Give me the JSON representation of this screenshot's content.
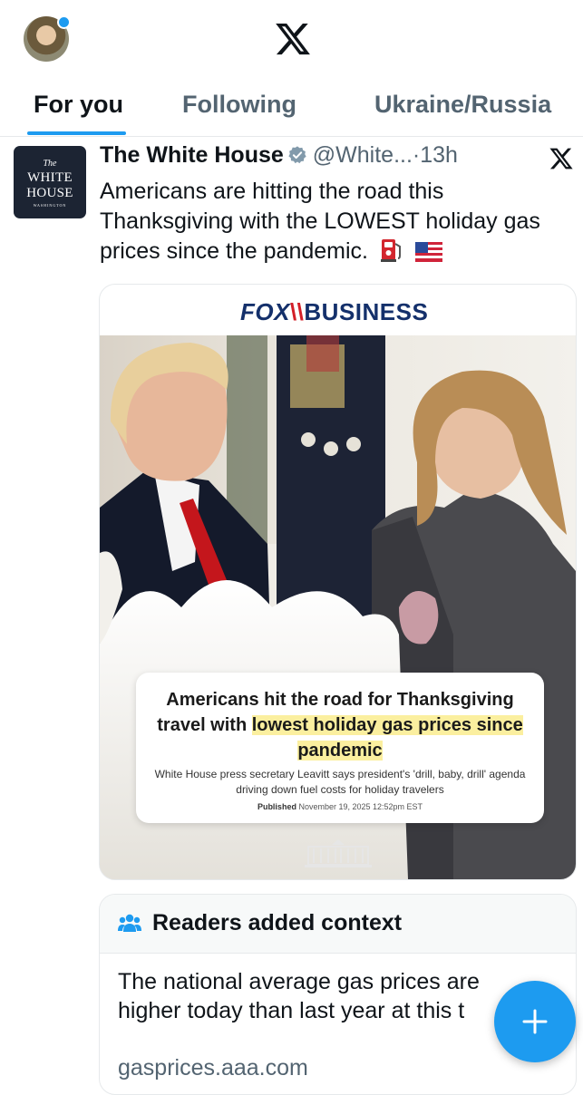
{
  "header": {
    "avatar": "profile-avatar",
    "logo_icon": "x-logo-icon"
  },
  "tabs": [
    {
      "label": "For you",
      "active": true
    },
    {
      "label": "Following",
      "active": false
    },
    {
      "label": "Ukraine/Russia",
      "active": false
    }
  ],
  "tweet": {
    "avatar": {
      "the": "The",
      "line1": "WHITE",
      "line2": "HOUSE",
      "line3": "WASHINGTON"
    },
    "author_name": "The White House",
    "verified_icon": "verified-badge-icon",
    "handle_time": "@White...·13h",
    "grok_icon": "grok-icon",
    "text": "Americans are hitting the road this Thanksgiving with the LOWEST holiday gas prices since the pandemic.",
    "emojis": [
      "fuel-pump-emoji",
      "us-flag-emoji"
    ],
    "media": {
      "brand": {
        "fox": "FOX",
        "business": "BUSINESS"
      },
      "headline_start": "Americans hit the road for Thanksgiving travel with ",
      "headline_highlight": "lowest holiday gas prices since pandemic",
      "subhead": "White House press secretary Leavitt says president's 'drill, baby, drill' agenda driving down fuel costs for holiday travelers",
      "published_label": "Published",
      "published_date": "November 19, 2025 12:52pm EST"
    }
  },
  "context_note": {
    "title": "Readers added context",
    "body_line1": "The national average gas prices are",
    "body_line2": "higher today than last year at this t",
    "link": "gasprices.aaa.com"
  },
  "fab": {
    "icon": "compose-plus-icon"
  },
  "colors": {
    "accent": "#1d9bf0",
    "text": "#0f1419",
    "muted": "#536471",
    "highlight": "#fbef9f"
  }
}
